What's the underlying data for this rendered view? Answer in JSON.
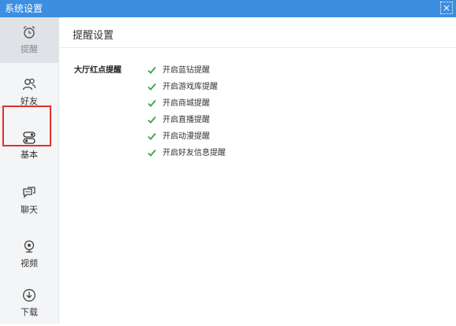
{
  "window": {
    "title": "系统设置",
    "close_glyph": "×"
  },
  "sidebar": {
    "items": [
      {
        "label": "提醒",
        "icon": "alarm-clock-icon"
      },
      {
        "label": "好友",
        "icon": "friends-icon"
      },
      {
        "label": "基本",
        "icon": "toggle-switch-icon"
      },
      {
        "label": "聊天",
        "icon": "chat-bubble-icon"
      },
      {
        "label": "视频",
        "icon": "webcam-icon"
      },
      {
        "label": "下载",
        "icon": "download-icon"
      }
    ],
    "active_index": 0,
    "highlighted_index": 2
  },
  "main": {
    "title": "提醒设置",
    "group_label": "大厅红点提醒",
    "options": [
      {
        "label": "开启蓝钻提醒",
        "checked": true
      },
      {
        "label": "开启游戏库提醒",
        "checked": true
      },
      {
        "label": "开启商城提醒",
        "checked": true
      },
      {
        "label": "开启直播提醒",
        "checked": true
      },
      {
        "label": "开启动漫提醒",
        "checked": true
      },
      {
        "label": "开启好友信息提醒",
        "checked": true
      }
    ]
  },
  "colors": {
    "titlebar": "#3b8ee0",
    "check": "#3aa53a",
    "highlight": "#e03030"
  }
}
